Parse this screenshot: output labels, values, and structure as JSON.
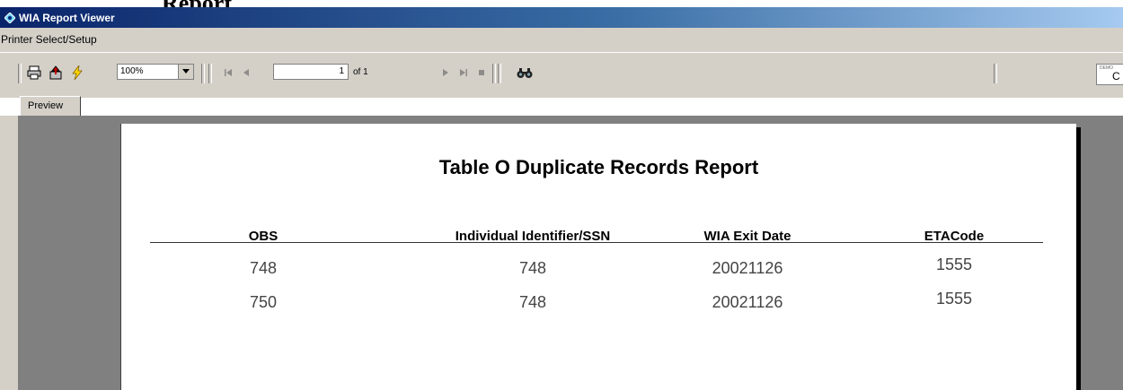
{
  "window": {
    "title": "WIA Report Viewer",
    "cropped_heading": "Report"
  },
  "menu": {
    "items": [
      "Printer Select/Setup"
    ]
  },
  "toolbar": {
    "zoom": "100%",
    "page_current": "1",
    "page_of": "of 1",
    "right_field_small": "DEMO",
    "right_field_big": "C",
    "icons": [
      "print-icon",
      "export-icon",
      "refresh-icon",
      "first-page-icon",
      "prev-page-icon",
      "next-page-icon",
      "last-page-icon",
      "stop-icon",
      "search-icon"
    ]
  },
  "tabs": [
    {
      "label": "Preview"
    }
  ],
  "report": {
    "title": "Table O Duplicate Records Report",
    "columns": [
      "OBS",
      "Individual Identifier/SSN",
      "WIA Exit Date",
      "ETACode"
    ],
    "rows": [
      [
        "748",
        "748",
        "20021126",
        "1555"
      ],
      [
        "750",
        "748",
        "20021126",
        "1555"
      ]
    ]
  },
  "colors": {
    "titlebar_start": "#0a246a",
    "titlebar_end": "#a6caf0",
    "chrome": "#d4d0c8",
    "preview_bg": "#808080"
  }
}
